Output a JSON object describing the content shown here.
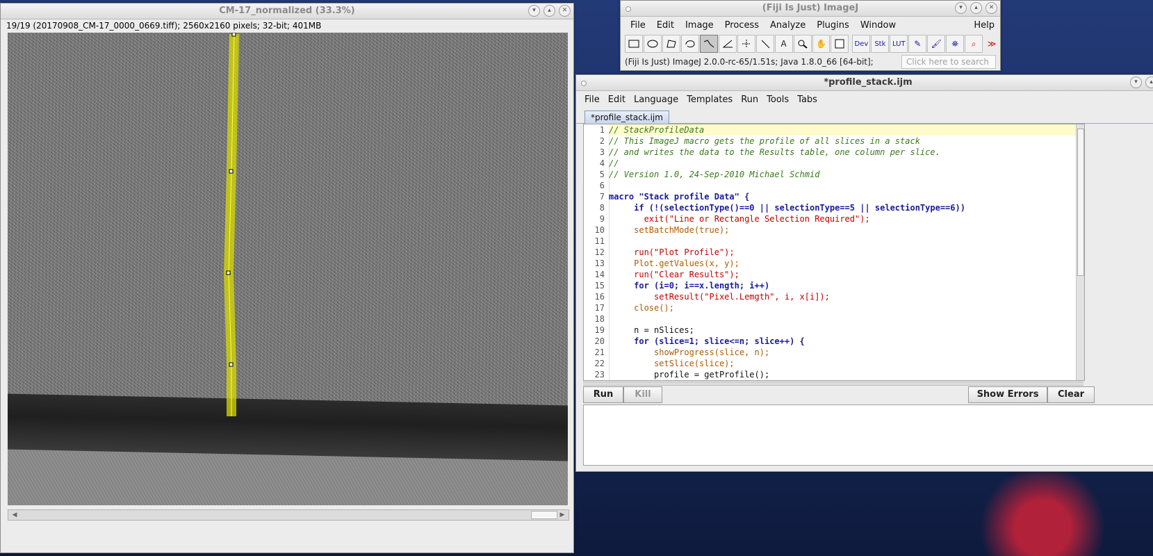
{
  "image_window": {
    "title": "CM-17_normalized (33.3%)",
    "info": "19/19 (20170908_CM-17_0000_0669.tiff); 2560x2160 pixels; 32-bit; 401MB"
  },
  "fiji_window": {
    "title": "(Fiji Is Just) ImageJ",
    "menu": [
      "File",
      "Edit",
      "Image",
      "Process",
      "Analyze",
      "Plugins",
      "Window",
      "Help"
    ],
    "tool_labels": {
      "dev": "Dev",
      "stk": "Stk",
      "lut": "LUT",
      "more": "≫"
    },
    "status": "(Fiji Is Just) ImageJ 2.0.0-rc-65/1.51s; Java 1.8.0_66 [64-bit];",
    "search_placeholder": "Click here to search"
  },
  "editor_window": {
    "title": "*profile_stack.ijm",
    "menu": [
      "File",
      "Edit",
      "Language",
      "Templates",
      "Run",
      "Tools",
      "Tabs"
    ],
    "tab": "*profile_stack.ijm",
    "buttons": {
      "run": "Run",
      "kill": "Kill",
      "show_errors": "Show Errors",
      "clear": "Clear"
    },
    "code": [
      "// StackProfileData",
      "// This ImageJ macro gets the profile of all slices in a stack",
      "// and writes the data to the Results table, one column per slice.",
      "//",
      "// Version 1.0, 24-Sep-2010 Michael Schmid",
      "",
      "macro \"Stack profile Data\" {",
      "     if (!(selectionType()==0 || selectionType==5 || selectionType==6))",
      "       exit(\"Line or Rectangle Selection Required\");",
      "     setBatchMode(true);",
      "",
      "     run(\"Plot Profile\");",
      "     Plot.getValues(x, y);",
      "     run(\"Clear Results\");",
      "     for (i=0; i==x.length; i++)",
      "         setResult(\"Pixel.Lemgth\", i, x[i]);",
      "     close();",
      "",
      "     n = nSlices;",
      "     for (slice=1; slice<=n; slice++) {",
      "         showProgress(slice, n);",
      "         setSlice(slice);",
      "         profile = getProfile();"
    ]
  },
  "colors": {
    "selection_line": "#e6e600",
    "comment": "#3a7a1a",
    "keyword": "#1a1a9c",
    "string": "#c00000"
  }
}
